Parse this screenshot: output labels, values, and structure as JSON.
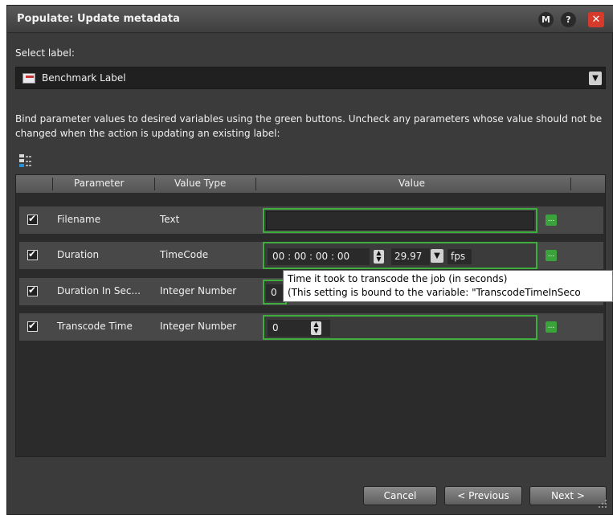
{
  "dialog": {
    "title": "Populate: Update metadata",
    "buttons": {
      "macro": "M",
      "help": "?",
      "close": "✕"
    }
  },
  "select_label": {
    "caption": "Select label:",
    "value": "Benchmark Label",
    "icon": "label-icon"
  },
  "instructions": "Bind parameter values to desired variables using the green buttons. Uncheck any parameters whose value should not be changed when the action is updating an existing label:",
  "grid": {
    "headers": [
      "Parameter",
      "Value Type",
      "Value"
    ],
    "rows": [
      {
        "checked": true,
        "parameter": "Filename",
        "value_type": "Text",
        "value": ""
      },
      {
        "checked": true,
        "parameter": "Duration",
        "value_type": "TimeCode",
        "timecode": "00 : 00 : 00 : 00",
        "fps_value": "29.97",
        "fps_label": "fps"
      },
      {
        "checked": true,
        "parameter": "Duration In Sec...",
        "value_type": "Integer Number",
        "value": "0"
      },
      {
        "checked": true,
        "parameter": "Transcode Time",
        "value_type": "Integer Number",
        "value": "0"
      }
    ],
    "bind_button": "..."
  },
  "tooltip": {
    "line1": "Time it took to transcode the job (in seconds)",
    "line2": "(This setting is bound to the variable: \"TranscodeTimeInSeco"
  },
  "footer": {
    "cancel": "Cancel",
    "previous": "< Previous",
    "next": "Next >"
  },
  "colors": {
    "accent_green": "#3fae3f",
    "close_red": "#d63a2a",
    "dialog_bg": "#3b3b3b"
  }
}
